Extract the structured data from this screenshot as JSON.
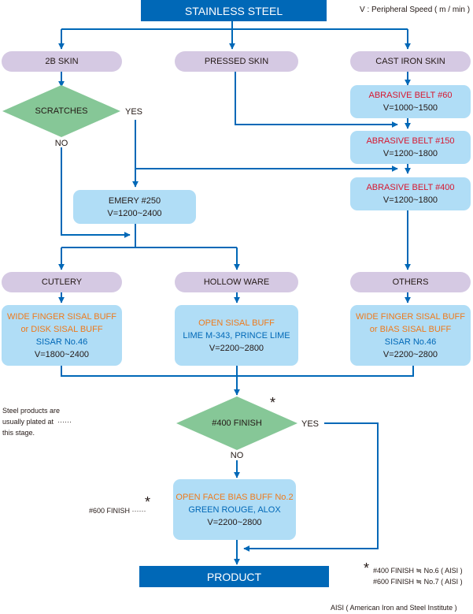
{
  "header": {
    "title": "STAINLESS STEEL",
    "legend": "V : Peripheral Speed ( m / min )"
  },
  "skins": {
    "twob": "2B SKIN",
    "pressed": "PRESSED SKIN",
    "cast_iron": "CAST IRON SKIN"
  },
  "decision_scratches": {
    "label": "SCRATCHES",
    "yes": "YES",
    "no": "NO"
  },
  "emery": {
    "line1": "EMERY #250",
    "line2": "V=1200~2400"
  },
  "abrasive_belts": [
    {
      "label": "ABRASIVE BELT #60",
      "speed": "V=1000~1500"
    },
    {
      "label": "ABRASIVE BELT #150",
      "speed": "V=1200~1800"
    },
    {
      "label": "ABRASIVE BELT #400",
      "speed": "V=1200~1800"
    }
  ],
  "products": {
    "cutlery": "CUTLERY",
    "hollow_ware": "HOLLOW WARE",
    "others": "OTHERS"
  },
  "buffing": {
    "cutlery": {
      "buff1": "WIDE FINGER SISAL BUFF",
      "buff2": "or DISK SISAL BUFF",
      "compound": "SISAR No.46",
      "speed": "V=1800~2400"
    },
    "hollow_ware": {
      "buff1": "OPEN SISAL BUFF",
      "compound": "LIME M-343, PRINCE LIME",
      "speed": "V=2200~2800"
    },
    "others": {
      "buff1": "WIDE FINGER SISAL BUFF",
      "buff2": "or BIAS SISAL BUFF",
      "compound": "SISAR No.46",
      "speed": "V=2200~2800"
    }
  },
  "decision_finish": {
    "label": "#400 FINISH",
    "yes": "YES",
    "no": "NO",
    "asterisk": "*"
  },
  "plating_note": {
    "line1": "Steel products are",
    "line2": "usually plated at",
    "line3": "this stage.",
    "leader": "······"
  },
  "final_buff": {
    "buff": "OPEN FACE BIAS BUFF No.2",
    "compound": "GREEN ROUGE, ALOX",
    "speed": "V=2200~2800"
  },
  "finish600_note": {
    "label": "#600 FINISH",
    "leader": "······",
    "asterisk": "*"
  },
  "product": "PRODUCT",
  "footnotes": {
    "asterisk": "*",
    "line1": "#400 FINISH ≒ No.6 ( AISI )",
    "line2": "#600 FINISH ≒ No.7 ( AISI )",
    "aisi": "AISI ( American Iron and Steel Institute )"
  },
  "colors": {
    "brand_blue": "#0068b7",
    "skin_purple": "#d5c9e3",
    "process_blue": "#b0ddf6",
    "decision_green": "#86c797",
    "buff_orange": "#ee7a1c",
    "belt_red": "#d7172f"
  }
}
